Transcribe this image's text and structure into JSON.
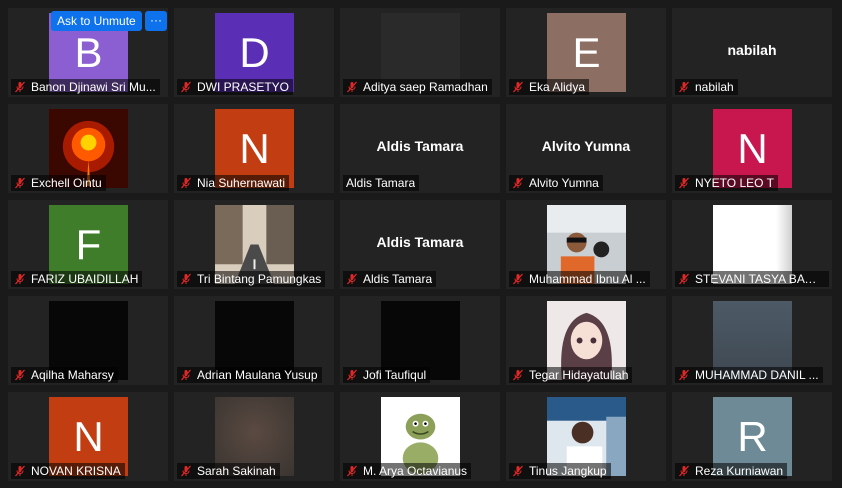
{
  "controls": {
    "unmute_label": "Ask to Unmute",
    "more_label": "···"
  },
  "participants": [
    {
      "name": "Banon Djinawi Sri Mu...",
      "letter": "B",
      "bg": "#8b5fd1",
      "muted": true
    },
    {
      "name": "DWI PRASETYO",
      "letter": "D",
      "bg": "#5b2fb5",
      "muted": true
    },
    {
      "name": "Aditya saep Ramadhan",
      "video": "dark-gray",
      "muted": true
    },
    {
      "name": "Eka Alidya",
      "letter": "E",
      "bg": "#8d6e63",
      "muted": true
    },
    {
      "name": "nabilah",
      "bigname": "nabilah",
      "muted": true
    },
    {
      "name": "Exchell Ointu",
      "video": "fire-flower",
      "muted": true
    },
    {
      "name": "Nia Suhernawati",
      "letter": "N",
      "bg": "#c23e12",
      "muted": true
    },
    {
      "name": "Aldis Tamara",
      "bigname": "Aldis Tamara",
      "muted": false
    },
    {
      "name": "Alvito Yumna",
      "bigname": "Alvito Yumna",
      "muted": true
    },
    {
      "name": "NYETO LEO T",
      "letter": "N",
      "bg": "#c8174f",
      "muted": true
    },
    {
      "name": "FARIZ UBAIDILLAH",
      "letter": "F",
      "bg": "#3f7d2b",
      "muted": true
    },
    {
      "name": "Tri Bintang Pamungkas",
      "video": "city-street",
      "muted": true
    },
    {
      "name": "Aldis Tamara",
      "bigname": "Aldis Tamara",
      "muted": true
    },
    {
      "name": "Muhammad Ibnu Al ...",
      "video": "pilot",
      "muted": true
    },
    {
      "name": "STEVANI TASYA BAWA...",
      "video": "white",
      "muted": true
    },
    {
      "name": "Aqilha Maharsy",
      "video": "black",
      "muted": true
    },
    {
      "name": "Adrian Maulana Yusup",
      "video": "black",
      "muted": true
    },
    {
      "name": "Jofi Taufiqul",
      "video": "black",
      "muted": true
    },
    {
      "name": "Tegar Hidayatullah",
      "video": "anime",
      "muted": true
    },
    {
      "name": "MUHAMMAD DANIL ...",
      "video": "blue-gray",
      "muted": true
    },
    {
      "name": "NOVAN KRISNA",
      "letter": "N",
      "bg": "#c23e12",
      "muted": true
    },
    {
      "name": "Sarah Sakinah",
      "video": "blur-brown",
      "muted": true
    },
    {
      "name": "M. Arya Octavianus",
      "video": "cartoon-dino",
      "muted": true
    },
    {
      "name": "Tinus Jangkup",
      "video": "person-sign",
      "muted": true
    },
    {
      "name": "Reza Kurniawan",
      "letter": "R",
      "bg": "#6d8a96",
      "muted": true
    }
  ]
}
